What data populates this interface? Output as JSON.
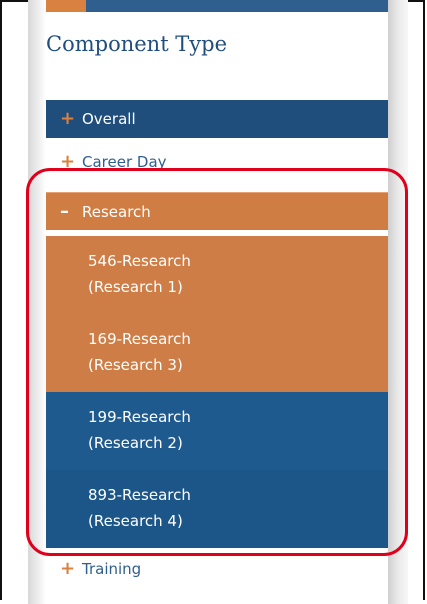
{
  "panel": {
    "title": "Component Type"
  },
  "categories": {
    "overall": {
      "sign": "+",
      "label": "Overall"
    },
    "career_day": {
      "sign": "+",
      "label": "Career Day"
    },
    "research": {
      "sign": "–",
      "label": "Research"
    },
    "training": {
      "sign": "+",
      "label": "Training"
    }
  },
  "research_items": [
    {
      "line1": "546-Research",
      "line2": "(Research 1)"
    },
    {
      "line1": "169-Research",
      "line2": "(Research 3)"
    },
    {
      "line1": "199-Research",
      "line2": "(Research 2)"
    },
    {
      "line1": "893-Research",
      "line2": "(Research 4)"
    }
  ],
  "colors": {
    "navy": "#1f4e7d",
    "orange": "#cf7d43",
    "highlight_red": "#e0001b"
  }
}
